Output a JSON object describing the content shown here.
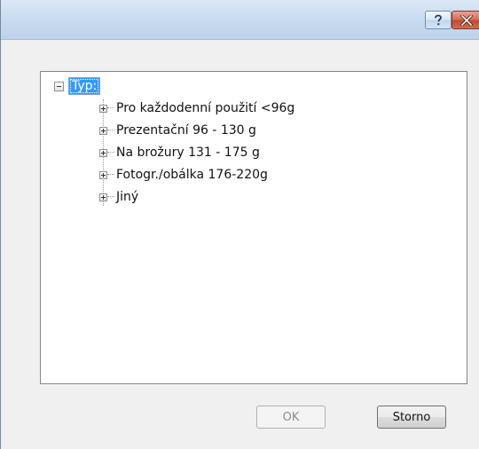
{
  "titlebar": {
    "help_icon": "question-mark-icon",
    "close_icon": "close-x-icon"
  },
  "tree": {
    "root_label": "Typ:",
    "items": [
      {
        "label": "Pro každodenní použití <96g"
      },
      {
        "label": "Prezentační 96 - 130 g"
      },
      {
        "label": "Na brožury 131 - 175 g"
      },
      {
        "label": "Fotogr./obálka 176-220g"
      },
      {
        "label": "Jiný"
      }
    ]
  },
  "buttons": {
    "ok_label": "OK",
    "cancel_label": "Storno"
  },
  "colors": {
    "selection": "#3399ff",
    "close_button": "#c9553e"
  }
}
